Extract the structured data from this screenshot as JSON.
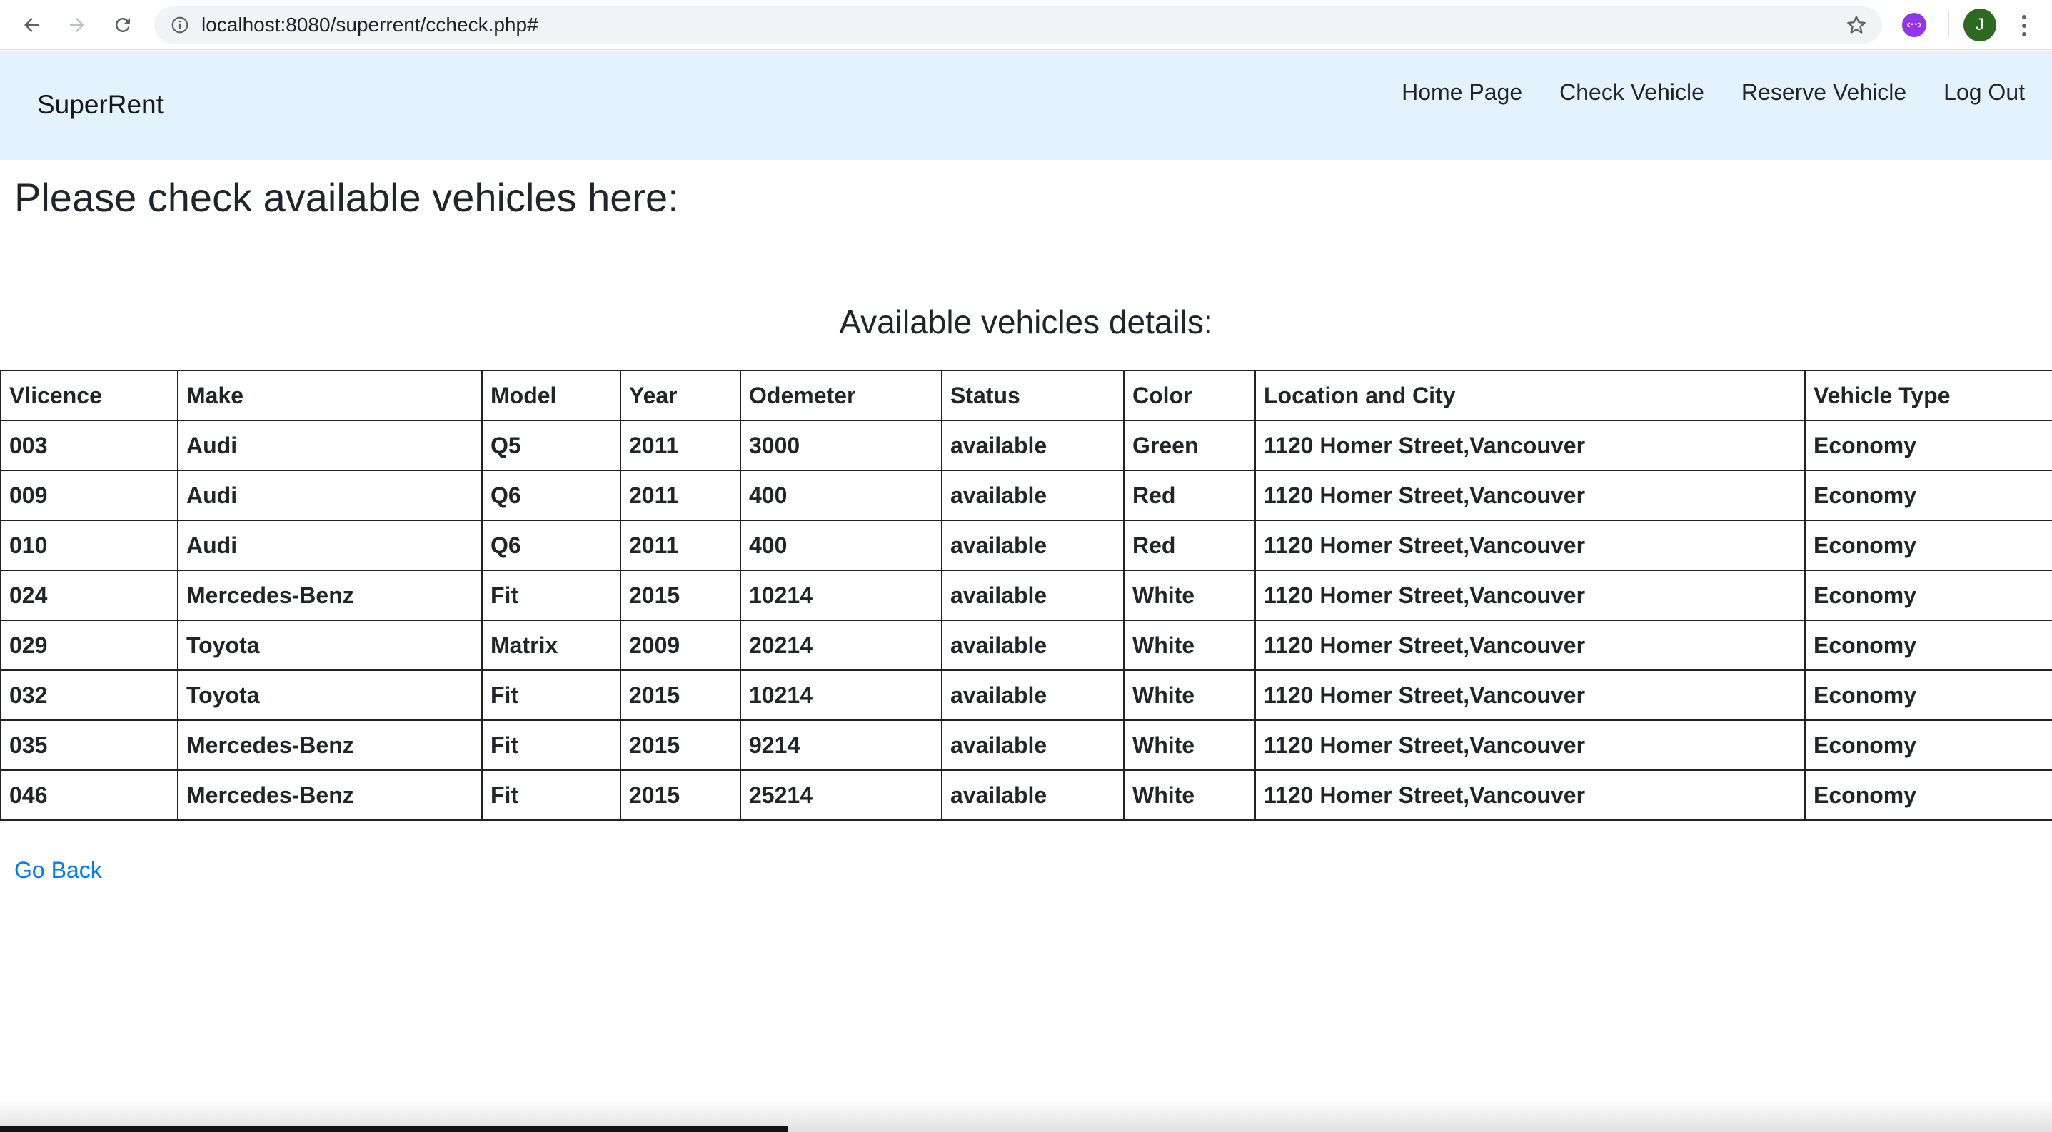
{
  "browser": {
    "url": "localhost:8080/superrent/ccheck.php#",
    "profile_initial": "J",
    "extension_label": "‹··›"
  },
  "navbar": {
    "brand": "SuperRent",
    "links": [
      "Home Page",
      "Check Vehicle",
      "Reserve Vehicle",
      "Log Out"
    ]
  },
  "page": {
    "heading": "Please check available vehicles here:",
    "subheading": "Available vehicles details:",
    "go_back": "Go Back"
  },
  "table": {
    "columns": [
      "Vlicence",
      "Make",
      "Model",
      "Year",
      "Odemeter",
      "Status",
      "Color",
      "Location and City",
      "Vehicle Type"
    ],
    "rows": [
      [
        "003",
        "Audi",
        "Q5",
        "2011",
        "3000",
        "available",
        "Green",
        "1120 Homer Street,Vancouver",
        "Economy"
      ],
      [
        "009",
        "Audi",
        "Q6",
        "2011",
        "400",
        "available",
        "Red",
        "1120 Homer Street,Vancouver",
        "Economy"
      ],
      [
        "010",
        "Audi",
        "Q6",
        "2011",
        "400",
        "available",
        "Red",
        "1120 Homer Street,Vancouver",
        "Economy"
      ],
      [
        "024",
        "Mercedes-Benz",
        "Fit",
        "2015",
        "10214",
        "available",
        "White",
        "1120 Homer Street,Vancouver",
        "Economy"
      ],
      [
        "029",
        "Toyota",
        "Matrix",
        "2009",
        "20214",
        "available",
        "White",
        "1120 Homer Street,Vancouver",
        "Economy"
      ],
      [
        "032",
        "Toyota",
        "Fit",
        "2015",
        "10214",
        "available",
        "White",
        "1120 Homer Street,Vancouver",
        "Economy"
      ],
      [
        "035",
        "Mercedes-Benz",
        "Fit",
        "2015",
        "9214",
        "available",
        "White",
        "1120 Homer Street,Vancouver",
        "Economy"
      ],
      [
        "046",
        "Mercedes-Benz",
        "Fit",
        "2015",
        "25214",
        "available",
        "White",
        "1120 Homer Street,Vancouver",
        "Economy"
      ]
    ]
  },
  "colors": {
    "navbar_bg": "#e3f2fd",
    "link": "#007bff",
    "profile_bg": "#2d6a1f",
    "extension_bg": "#9333ea"
  }
}
